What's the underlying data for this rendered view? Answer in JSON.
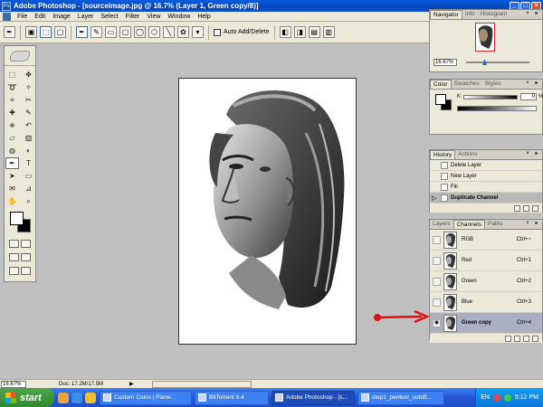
{
  "window": {
    "title": "Adobe Photoshop - [sourceimage.jpg @ 16.7% (Layer 1, Green copy/8)]",
    "controls": [
      "_",
      "□",
      "×"
    ]
  },
  "menu": [
    "File",
    "Edit",
    "Image",
    "Layer",
    "Select",
    "Filter",
    "View",
    "Window",
    "Help"
  ],
  "options_bar": {
    "auto_add_delete_label": "Auto Add/Delete"
  },
  "panels": {
    "navigator": {
      "tabs": [
        "Navigator",
        "Info",
        "Histogram"
      ],
      "zoom": "16.67%"
    },
    "color": {
      "tabs": [
        "Color",
        "Swatches",
        "Styles"
      ],
      "k_label": "K",
      "k_value": "0",
      "k_unit": "%"
    },
    "history": {
      "tabs": [
        "History",
        "Actions"
      ],
      "items": [
        "Delete Layer",
        "New Layer",
        "Fill",
        "Duplicate Channel"
      ],
      "selected_index": 3
    },
    "channels": {
      "tabs": [
        "Layers",
        "Channels",
        "Paths"
      ],
      "rows": [
        {
          "name": "RGB",
          "shortcut": "Ctrl+~",
          "visible": false
        },
        {
          "name": "Red",
          "shortcut": "Ctrl+1",
          "visible": false
        },
        {
          "name": "Green",
          "shortcut": "Ctrl+2",
          "visible": false
        },
        {
          "name": "Blue",
          "shortcut": "Ctrl+3",
          "visible": false
        },
        {
          "name": "Green copy",
          "shortcut": "Ctrl+4",
          "visible": true
        }
      ],
      "selected_index": 4
    }
  },
  "status": {
    "zoom": "16.67%",
    "doc": "Doc: 17.2M/17.5M",
    "arrow": "▶"
  },
  "taskbar": {
    "start_label": "start",
    "buttons": [
      {
        "label": "Custom Coins | Plane...",
        "active": false
      },
      {
        "label": "BitTorrent 6.4",
        "active": false
      },
      {
        "label": "Adobe Photoshop - [s...",
        "active": true
      },
      {
        "label": "step1_pentool_cutoff...",
        "active": false
      }
    ],
    "lang": "EN",
    "clock": "5:12 PM"
  },
  "colors": {
    "annotation_arrow": "#e01010",
    "selection_blue": "#316ac5"
  },
  "icons": {
    "tools": [
      "marquee-icon",
      "move-icon",
      "lasso-icon",
      "magic-wand-icon",
      "crop-icon",
      "slice-icon",
      "healing-brush-icon",
      "brush-icon",
      "clone-stamp-icon",
      "history-brush-icon",
      "eraser-icon",
      "gradient-icon",
      "blur-icon",
      "dodge-icon",
      "pen-icon",
      "type-icon",
      "path-select-icon",
      "shape-icon",
      "notes-icon",
      "eyedropper-icon",
      "hand-icon",
      "zoom-icon"
    ]
  }
}
